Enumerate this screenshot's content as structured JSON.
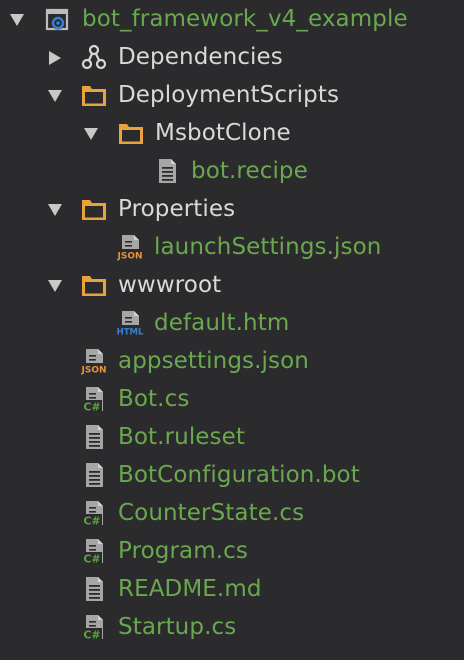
{
  "colors": {
    "background": "#2b2b2d",
    "folder_text": "#d9d9d9",
    "file_text": "#6aa84f",
    "folder_icon": "#e8a33c",
    "arrow": "#c8c8c8",
    "csharp_badge": "#5aa541",
    "json_badge": "#e8913a",
    "html_badge": "#3a7fd6"
  },
  "tree": {
    "project": {
      "label": "bot_framework_v4_example",
      "icon": "project-icon",
      "expanded": true
    },
    "dependencies": {
      "label": "Dependencies",
      "icon": "dependencies-icon",
      "expanded": false
    },
    "deployment_scripts": {
      "label": "DeploymentScripts",
      "icon": "folder-icon",
      "expanded": true
    },
    "msbot_clone": {
      "label": "MsbotClone",
      "icon": "folder-icon",
      "expanded": true
    },
    "bot_recipe": {
      "label": "bot.recipe",
      "icon": "text-file-icon"
    },
    "properties": {
      "label": "Properties",
      "icon": "folder-icon",
      "expanded": true
    },
    "launch_settings": {
      "label": "launchSettings.json",
      "icon": "json-file-icon",
      "badge": "JSON"
    },
    "wwwroot": {
      "label": "wwwroot",
      "icon": "folder-icon",
      "expanded": true
    },
    "default_htm": {
      "label": "default.htm",
      "icon": "html-file-icon",
      "badge": "HTML"
    },
    "appsettings": {
      "label": "appsettings.json",
      "icon": "json-file-icon",
      "badge": "JSON"
    },
    "bot_cs": {
      "label": "Bot.cs",
      "icon": "csharp-file-icon",
      "badge": "C#"
    },
    "bot_ruleset": {
      "label": "Bot.ruleset",
      "icon": "text-file-icon"
    },
    "bot_configuration": {
      "label": "BotConfiguration.bot",
      "icon": "text-file-icon"
    },
    "counter_state": {
      "label": "CounterState.cs",
      "icon": "csharp-file-icon",
      "badge": "C#"
    },
    "program_cs": {
      "label": "Program.cs",
      "icon": "csharp-file-icon",
      "badge": "C#"
    },
    "readme": {
      "label": "README.md",
      "icon": "text-file-icon"
    },
    "startup_cs": {
      "label": "Startup.cs",
      "icon": "csharp-file-icon",
      "badge": "C#"
    }
  }
}
